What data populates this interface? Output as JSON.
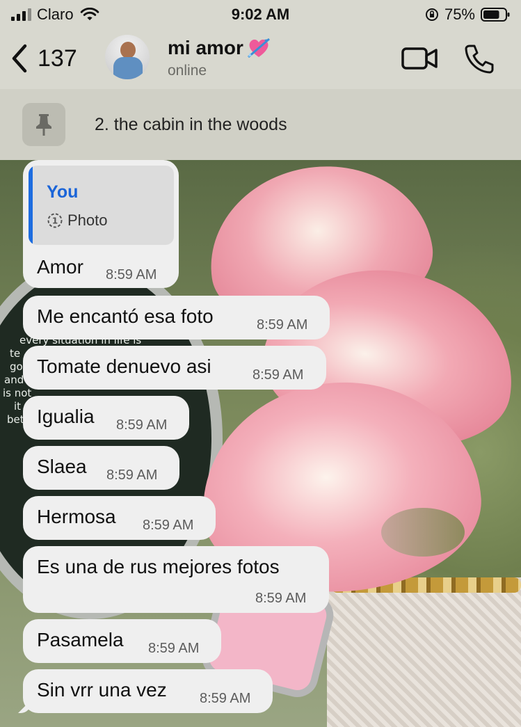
{
  "status_bar": {
    "carrier": "Claro",
    "time": "9:02 AM",
    "battery_percent": "75%",
    "battery_level": 0.75,
    "icons": [
      "signal-icon",
      "wifi-icon",
      "rotation-lock-icon",
      "battery-icon"
    ]
  },
  "header": {
    "back_count": "137",
    "contact_name": "mi amor",
    "contact_status": "online",
    "icons": [
      "back-chevron-icon",
      "heart-arrow-emoji-icon",
      "video-call-icon",
      "phone-icon"
    ]
  },
  "pinned": {
    "text": "2. the cabin in the woods",
    "icon": "pin-icon"
  },
  "wallpaper": {
    "text_lines": [
      "every situation in life is",
      "te",
      "go",
      "and",
      "is not",
      "it",
      "bet"
    ]
  },
  "messages": [
    {
      "reply": {
        "author": "You",
        "media_label": "Photo",
        "icon": "view-once-icon"
      },
      "text": "Amor",
      "time": "8:59 AM"
    },
    {
      "text": "Me encantó esa foto",
      "time": "8:59 AM"
    },
    {
      "text": "Tomate denuevo asi",
      "time": "8:59 AM"
    },
    {
      "text": "Igualia",
      "time": "8:59 AM"
    },
    {
      "text": "Slaea",
      "time": "8:59 AM"
    },
    {
      "text": "Hermosa",
      "time": "8:59 AM"
    },
    {
      "text": "Es una de rus mejores fotos",
      "time": "8:59 AM"
    },
    {
      "text": "Pasamela",
      "time": "8:59 AM"
    },
    {
      "text": "Sin vrr una vez",
      "time": "8:59 AM"
    }
  ],
  "colors": {
    "bubble": "#efefef",
    "reply_accent": "#1e6de0",
    "header_bg": "#d8d8cf"
  }
}
